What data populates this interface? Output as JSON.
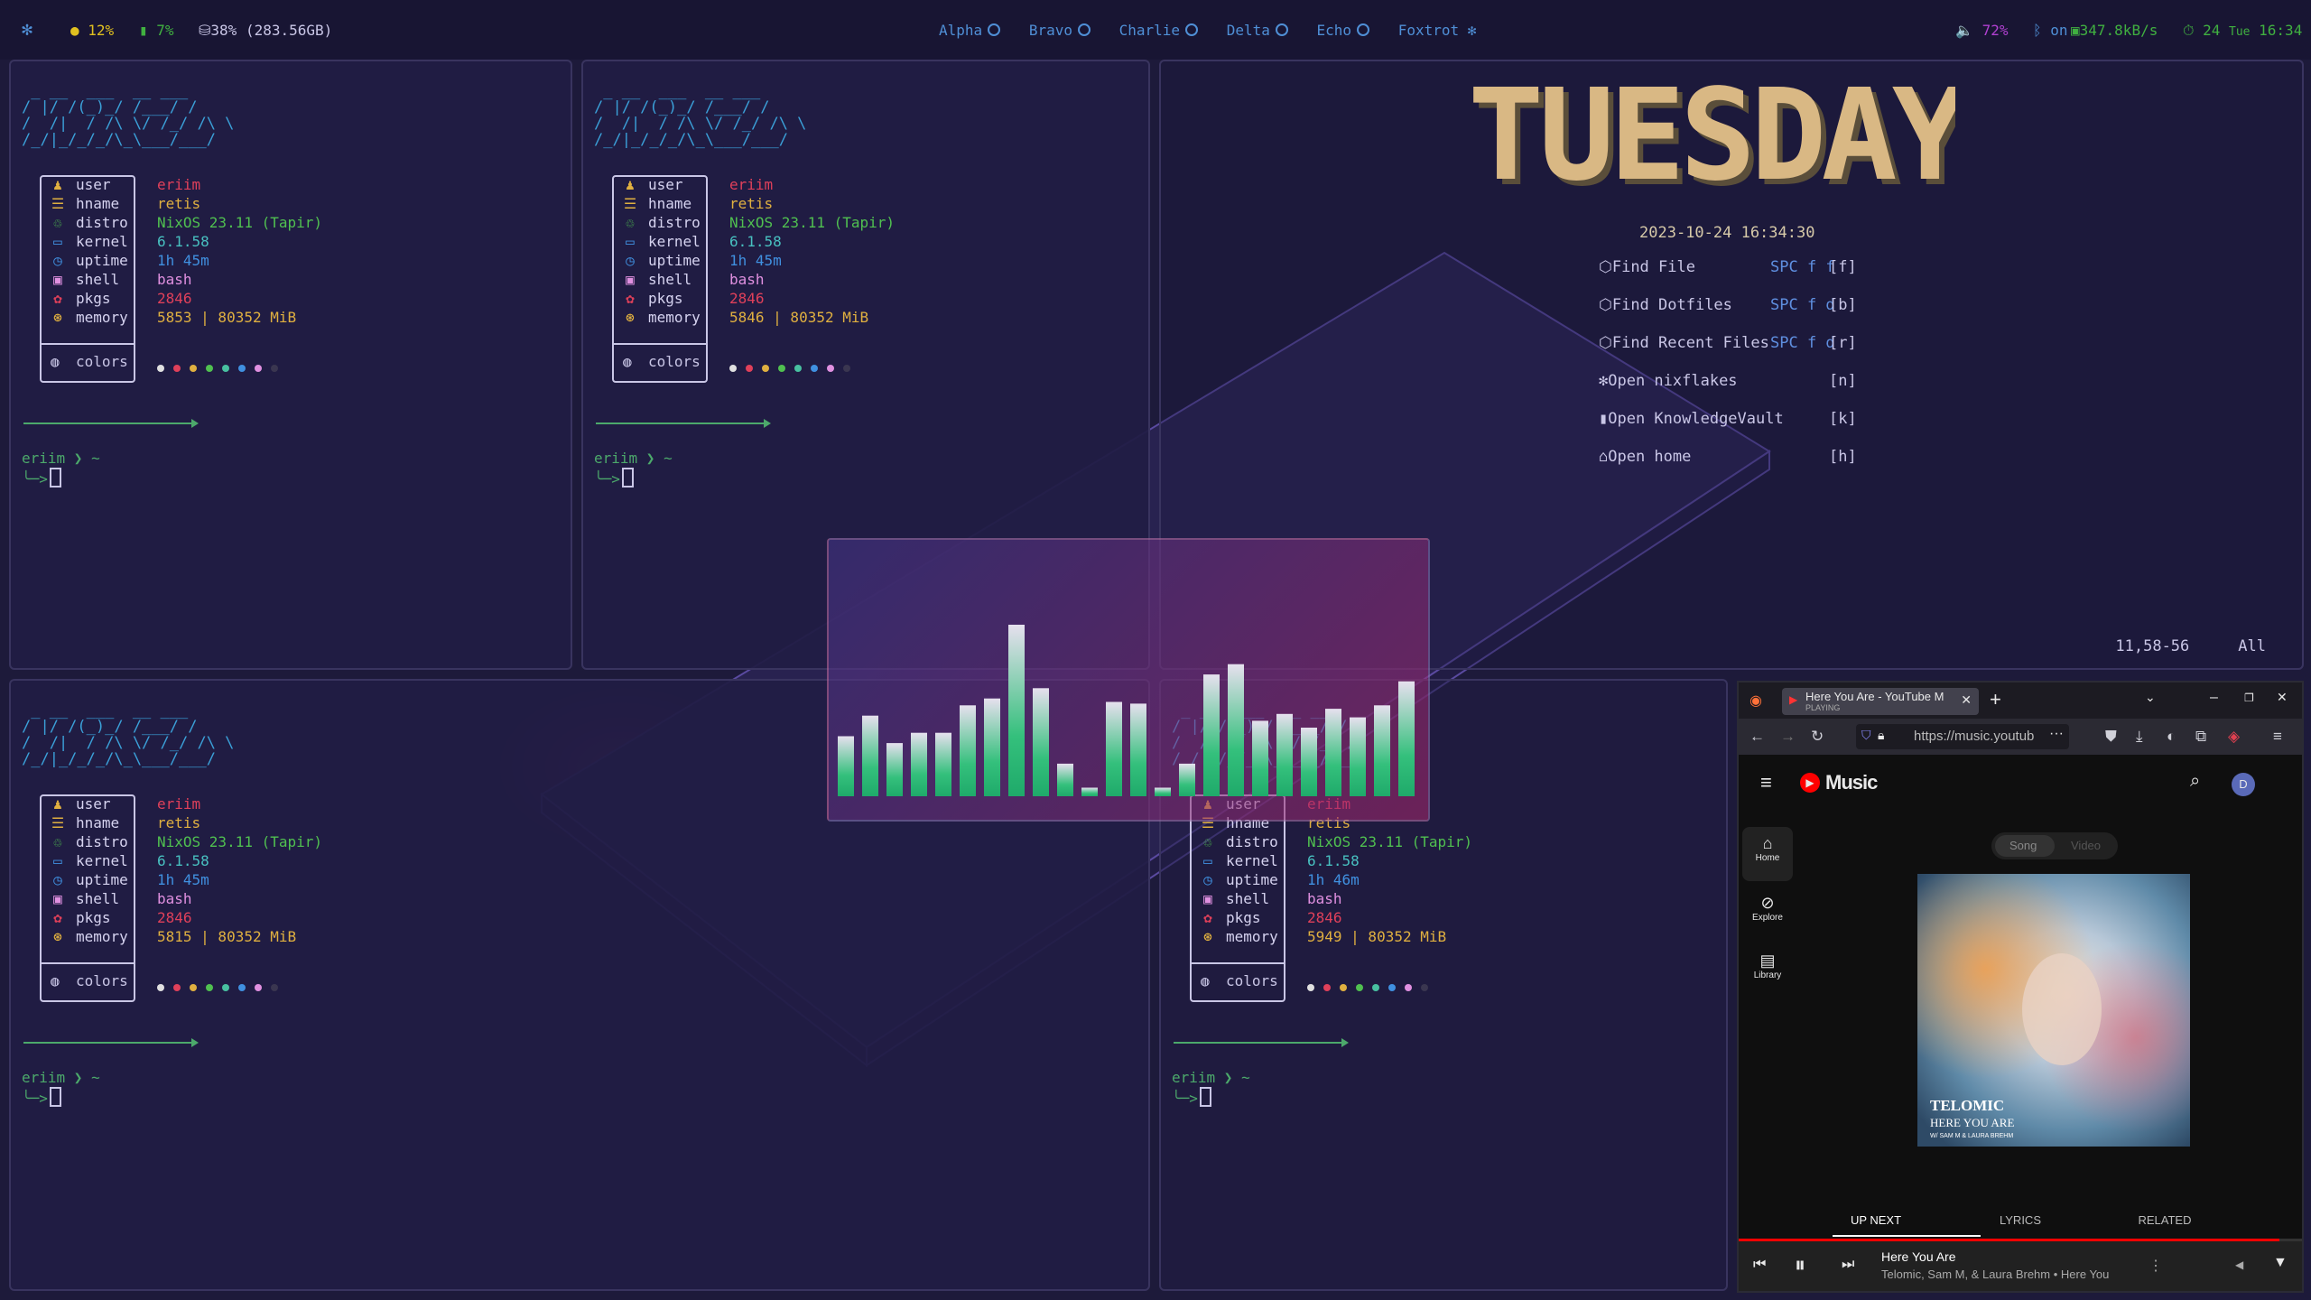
{
  "topbar": {
    "gear_icon": "gear-icon",
    "cpu": "12%",
    "battery": "7%",
    "disk": "38% (283.56GB)",
    "workspaces": [
      "Alpha",
      "Bravo",
      "Charlie",
      "Delta",
      "Echo",
      "Foxtrot"
    ],
    "volume": "72%",
    "bluetooth": "on",
    "network": "347.8kB/s",
    "clock_day": "24",
    "clock_weekday": "Tue",
    "clock_time": "16:34"
  },
  "ascii_logo": " _ __  ___  __ ___ \n/ |/ /(_)_/ /___/ /  \n/  /|  / /\\ \\/ /_/ /\\ \\ \n/_/|_/_/_/\\_\\___/___/",
  "terminals": [
    {
      "user": "eriim",
      "hname": "retis",
      "distro": "NixOS 23.11 (Tapir)",
      "kernel": "6.1.58",
      "uptime": "1h 45m",
      "shell": "bash",
      "pkgs": "2846",
      "memory": "5853 | 80352 MiB",
      "colors_label": "colors",
      "prompt_user": "eriim",
      "prompt_path": "~"
    },
    {
      "user": "eriim",
      "hname": "retis",
      "distro": "NixOS 23.11 (Tapir)",
      "kernel": "6.1.58",
      "uptime": "1h 45m",
      "shell": "bash",
      "pkgs": "2846",
      "memory": "5846 | 80352 MiB",
      "colors_label": "colors",
      "prompt_user": "eriim",
      "prompt_path": "~"
    },
    {
      "user": "eriim",
      "hname": "retis",
      "distro": "NixOS 23.11 (Tapir)",
      "kernel": "6.1.58",
      "uptime": "1h 45m",
      "shell": "bash",
      "pkgs": "2846",
      "memory": "5815 | 80352 MiB",
      "colors_label": "colors",
      "prompt_user": "eriim",
      "prompt_path": "~"
    },
    {
      "user": "eriim",
      "hname": "retis",
      "distro": "NixOS 23.11 (Tapir)",
      "kernel": "6.1.58",
      "uptime": "1h 46m",
      "shell": "bash",
      "pkgs": "2846",
      "memory": "5949 | 80352 MiB",
      "colors_label": "colors",
      "prompt_user": "eriim",
      "prompt_path": "~"
    }
  ],
  "labels": {
    "user": "user",
    "hname": "hname",
    "distro": "distro",
    "kernel": "kernel",
    "uptime": "uptime",
    "shell": "shell",
    "pkgs": "pkgs",
    "memory": "memory"
  },
  "palette": [
    "#e0e0e0",
    "#e0405a",
    "#e0b040",
    "#50c050",
    "#48c0a0",
    "#4090e0",
    "#e090e0",
    "#3a3650"
  ],
  "dashboard": {
    "banner": "TUESDAY",
    "datetime": "2023-10-24 16:34:30",
    "menu": [
      {
        "label": "Find File",
        "key": "SPC f f",
        "shortcut": "[f]"
      },
      {
        "label": "Find Dotfiles",
        "key": "SPC f d",
        "shortcut": "[b]"
      },
      {
        "label": "Find Recent Files",
        "key": "SPC f d",
        "shortcut": "[r]"
      },
      {
        "label": "Open nixflakes",
        "key": "",
        "shortcut": "[n]"
      },
      {
        "label": "Open KnowledgeVault",
        "key": "",
        "shortcut": "[k]"
      },
      {
        "label": "Open home",
        "key": "",
        "shortcut": "[h]"
      }
    ],
    "status_pos": "11,58-56",
    "status_all": "All"
  },
  "visualizer": {
    "levels": [
      0.35,
      0.47,
      0.31,
      0.37,
      0.37,
      0.53,
      0.57,
      1.0,
      0.63,
      0.19,
      0.05,
      0.55,
      0.54,
      0.05,
      0.19,
      0.71,
      0.77,
      0.44,
      0.48,
      0.4,
      0.51,
      0.46,
      0.53,
      0.67
    ]
  },
  "browser": {
    "tab_title": "Here You Are - YouTube M",
    "tab_status": "PLAYING",
    "url": "https://music.youtub",
    "brand": "Music",
    "avatar_letter": "D",
    "toggle_song": "Song",
    "toggle_video": "Video",
    "nav": [
      {
        "label": "Home",
        "icon": "home-icon"
      },
      {
        "label": "Explore",
        "icon": "compass-icon"
      },
      {
        "label": "Library",
        "icon": "library-icon"
      }
    ],
    "album_title": "TELOMIC",
    "album_subtitle": "HERE YOU ARE",
    "album_credit": "W/ SAM M & LAURA BREHM",
    "tabs": [
      "UP NEXT",
      "LYRICS",
      "RELATED"
    ],
    "track_title": "Here You Are",
    "track_artist": "Telomic, Sam M, & Laura Brehm • Here You"
  }
}
